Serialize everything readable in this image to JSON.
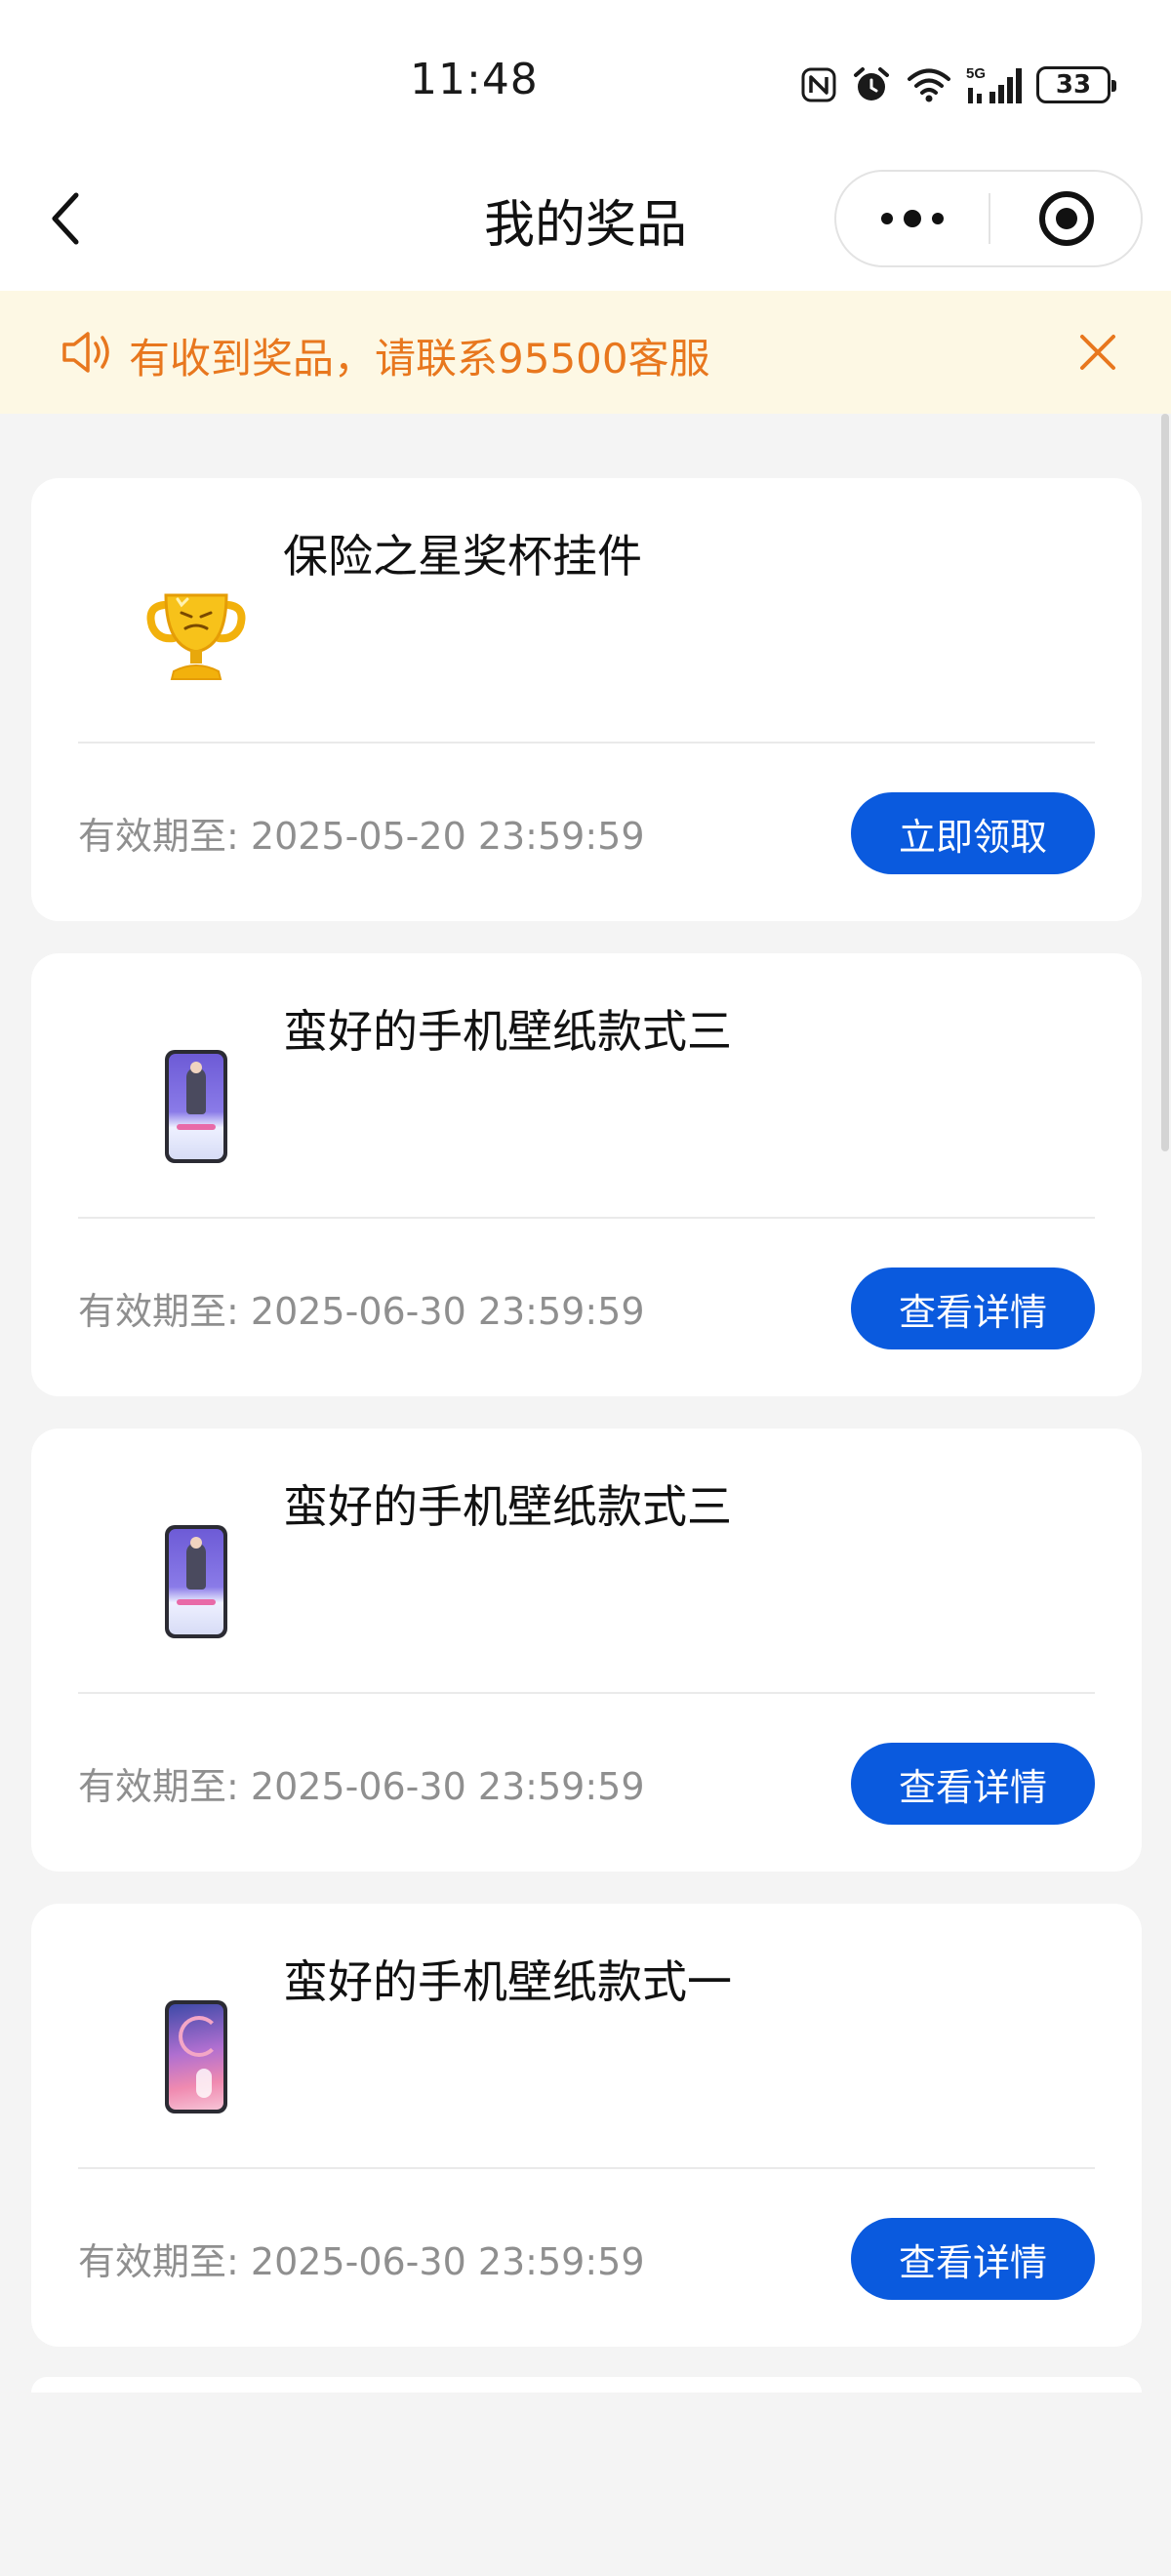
{
  "status_bar": {
    "time": "11:48",
    "battery": "33",
    "signal_label": "5G",
    "icons": [
      "nfc-icon",
      "alarm-icon",
      "wifi-icon",
      "5g-signal-icon",
      "battery-icon"
    ]
  },
  "nav": {
    "title": "我的奖品",
    "back_icon": "chevron-left-icon",
    "more_icon": "more-dots-icon",
    "close_icon": "target-close-icon"
  },
  "notice": {
    "icon": "speaker-icon",
    "text": "有收到奖品，请联系95500客服",
    "close_icon": "close-icon",
    "color": "#e8771e",
    "background": "#fdf8e4"
  },
  "prizes": [
    {
      "title": "保险之星奖杯挂件",
      "expiry_label": "有效期至:",
      "expiry_value": "2025-05-20 23:59:59",
      "button": "立即领取",
      "thumb": "trophy-icon"
    },
    {
      "title": "蛮好的手机壁纸款式三",
      "expiry_label": "有效期至:",
      "expiry_value": "2025-06-30 23:59:59",
      "button": "查看详情",
      "thumb": "wallpaper-thumbnail"
    },
    {
      "title": "蛮好的手机壁纸款式三",
      "expiry_label": "有效期至:",
      "expiry_value": "2025-06-30 23:59:59",
      "button": "查看详情",
      "thumb": "wallpaper-thumbnail"
    },
    {
      "title": "蛮好的手机壁纸款式一",
      "expiry_label": "有效期至:",
      "expiry_value": "2025-06-30 23:59:59",
      "button": "查看详情",
      "thumb": "wallpaper-thumbnail"
    }
  ],
  "colors": {
    "accent": "#0a5ade",
    "background": "#f4f4f4",
    "expiry_text": "#8f8f8f"
  }
}
